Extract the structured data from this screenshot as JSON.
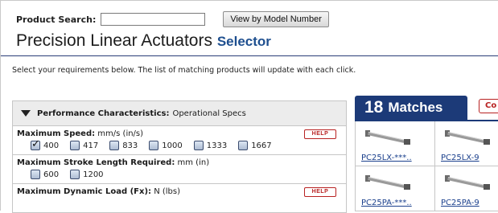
{
  "search": {
    "label": "Product Search:",
    "value": "",
    "placeholder": "",
    "view_button": "View by Model Number"
  },
  "title": {
    "main": "Precision Linear Actuators",
    "sub": "Selector"
  },
  "instructions": "Select your requirements below. The list of matching products will update with each click.",
  "filters_panel": {
    "header_bold": "Performance Characteristics:",
    "header_rest": "Operational Specs",
    "help_label": "HELP",
    "filters": [
      {
        "title": "Maximum Speed:",
        "unit": "mm/s (in/s)",
        "options": [
          {
            "label": "400",
            "checked": true
          },
          {
            "label": "417",
            "checked": false
          },
          {
            "label": "833",
            "checked": false
          },
          {
            "label": "1000",
            "checked": false
          },
          {
            "label": "1333",
            "checked": false
          },
          {
            "label": "1667",
            "checked": false
          }
        ]
      },
      {
        "title": "Maximum Stroke Length Required:",
        "unit": "mm (in)",
        "options": [
          {
            "label": "600",
            "checked": false
          },
          {
            "label": "1200",
            "checked": false
          }
        ]
      },
      {
        "title": "Maximum Dynamic Load (Fx):",
        "unit": "N (lbs)",
        "options": []
      }
    ]
  },
  "matches": {
    "count": "18",
    "label": "Matches",
    "compare_label": "Co",
    "products": [
      {
        "model": "PC25LX-***.."
      },
      {
        "model": "PC25LX-9"
      },
      {
        "model": "PC25PA-***.."
      },
      {
        "model": "PC25PA-9"
      }
    ]
  },
  "colors": {
    "navy": "#1c3a78",
    "help_red": "#b82222",
    "title_blue": "#1e4f8f",
    "link_blue": "#1a3f8c"
  }
}
